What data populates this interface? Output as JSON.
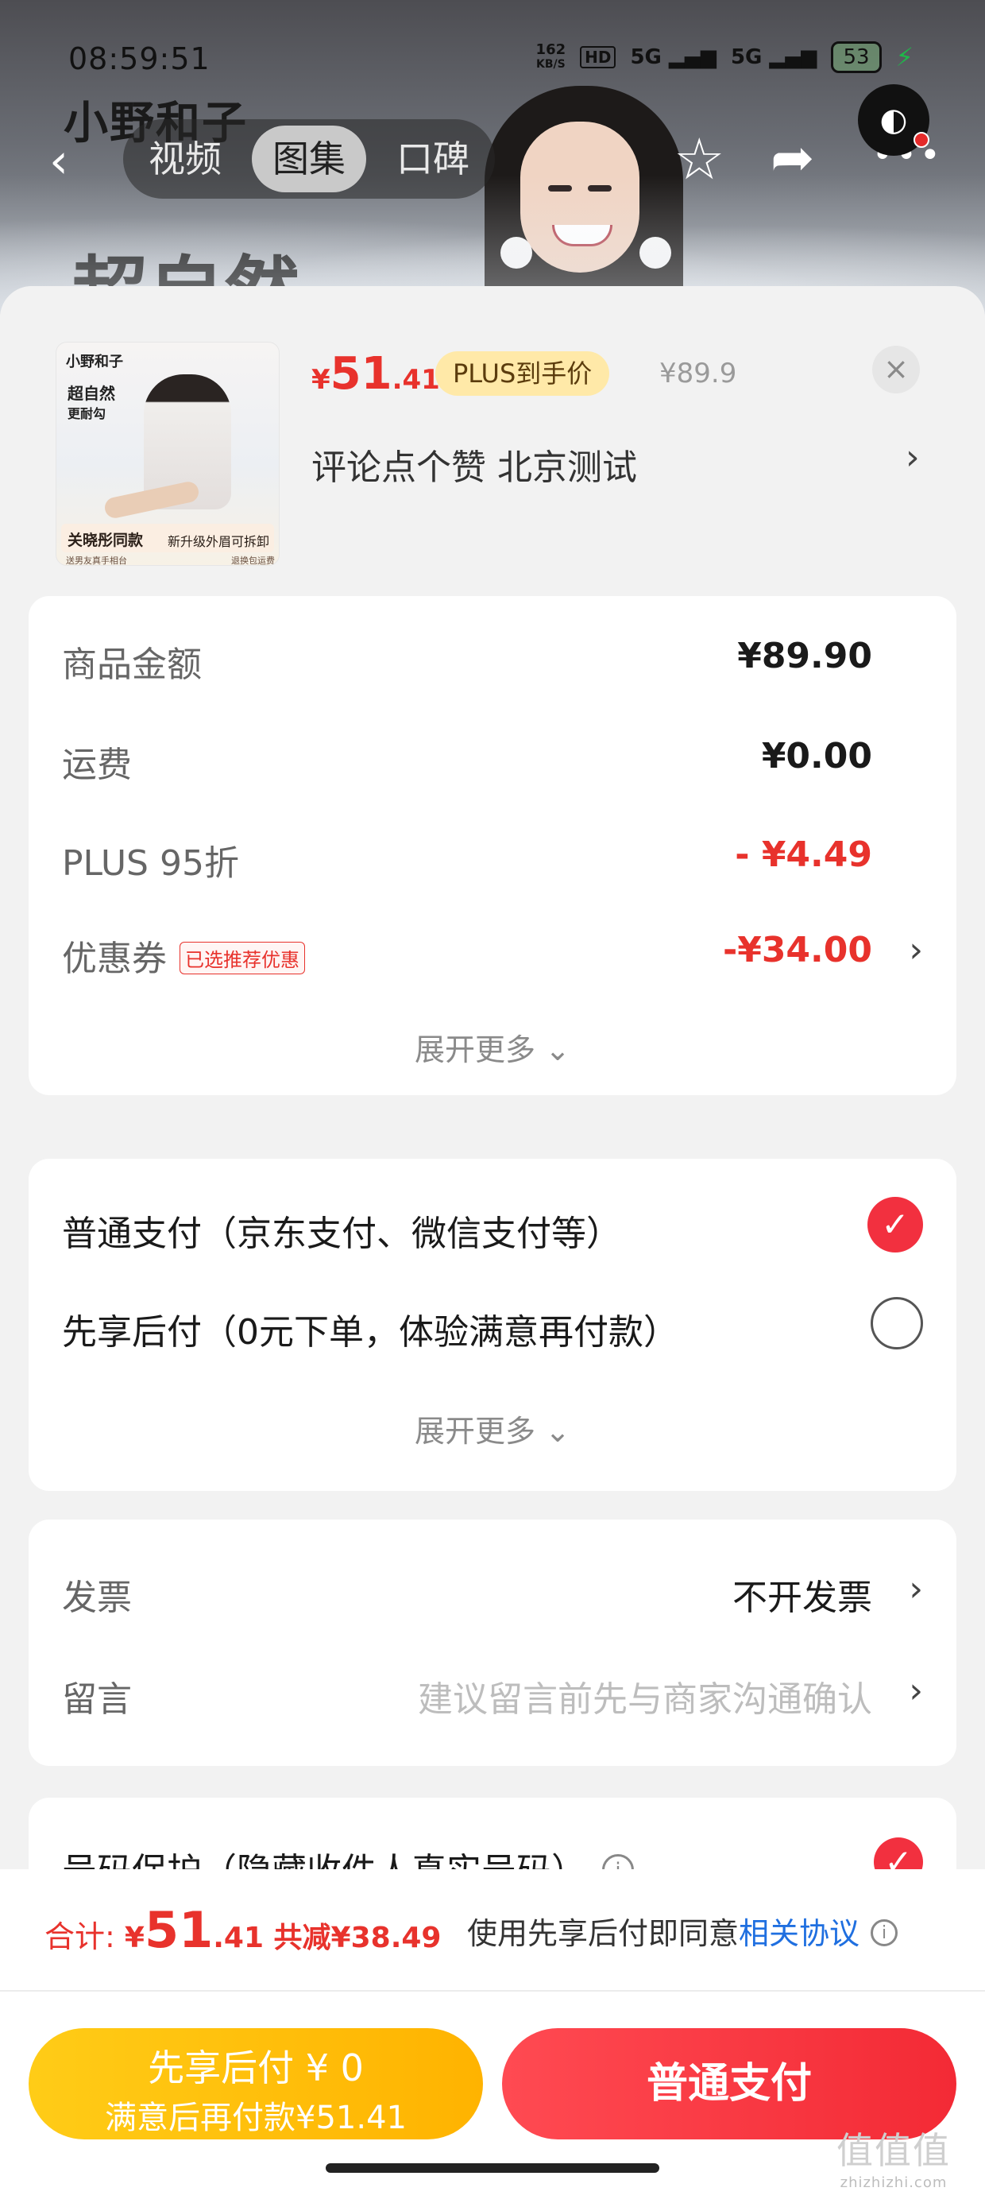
{
  "status_bar": {
    "time": "08:59:51",
    "net_speed_value": "162",
    "net_speed_unit": "KB/S",
    "hd_label": "HD",
    "sig1": "5G",
    "sig2": "5G",
    "battery": "53"
  },
  "header": {
    "brand": "小野和子",
    "tabs": [
      {
        "label": "视频"
      },
      {
        "label": "图集"
      },
      {
        "label": "口碑"
      }
    ],
    "headline": "超自然"
  },
  "product": {
    "thumb": {
      "brand": "小野和子",
      "title1": "超自然",
      "title2": "更耐勾",
      "band_left": "关晓彤同款",
      "band_right": "新升级外眉可拆卸",
      "foot_left": "送男友真手相台",
      "foot_right": "退换包运费"
    },
    "price_currency": "¥",
    "price_int": "51",
    "price_dec": ".41",
    "plus_label": "PLUS到手价",
    "original_price": "¥89.9",
    "spec": "评论点个赞  北京测试"
  },
  "amounts": {
    "goods_label": "商品金额",
    "goods_value": "¥89.90",
    "ship_label": "运费",
    "ship_value": "¥0.00",
    "plus_label": "PLUS 95折",
    "plus_value": "- ¥4.49",
    "coupon_label": "优惠券",
    "coupon_tag": "已选推荐优惠",
    "coupon_value": "-¥34.00",
    "more": "展开更多 ⌄"
  },
  "payment": {
    "normal": "普通支付（京东支付、微信支付等）",
    "later": "先享后付（0元下单，体验满意再付款）",
    "more": "展开更多 ⌄",
    "normal_checked": true,
    "later_checked": false
  },
  "extras": {
    "invoice_label": "发票",
    "invoice_value": "不开发票",
    "note_label": "留言",
    "note_placeholder": "建议留言前先与商家沟通确认"
  },
  "privacy": {
    "label": "号码保护（隐藏收件人真实号码）",
    "checked": true
  },
  "footer": {
    "total_label": "合计: ",
    "total_cur": "¥",
    "total_int": "51",
    "total_dec": ".41",
    "discount": " 共减¥38.49",
    "agree_text": "使用先享后付即同意",
    "agree_link": "相关协议",
    "btn_later_l1": "先享后付 ¥ 0",
    "btn_later_l2": "满意后再付款¥51.41",
    "btn_normal": "普通支付"
  },
  "watermark": {
    "text": "值值值",
    "domain": "zhizhizhi.com"
  },
  "colors": {
    "accent_red": "#e8322c",
    "pay_red": "#f32a35",
    "later_yellow": "#ffb300",
    "link_blue": "#1f6fe0"
  }
}
